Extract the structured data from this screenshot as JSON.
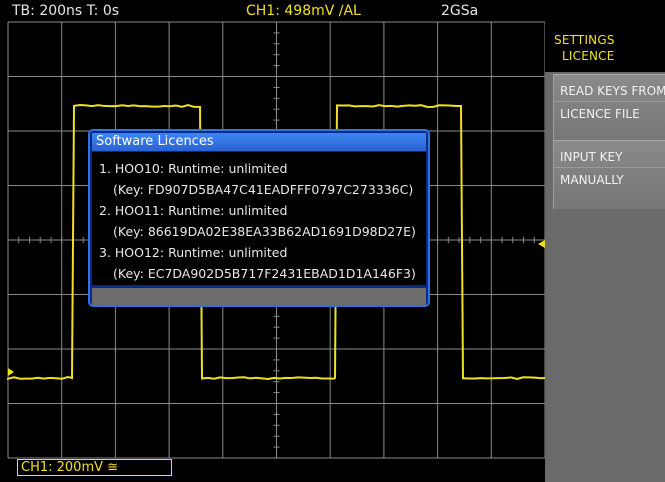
{
  "status": {
    "timebase": "TB: 200ns  T: 0s",
    "channel": "CH1: 498mV ∕AL",
    "sample_rate": "2GSa"
  },
  "side_panel": {
    "title_line1": "SETTINGS",
    "title_line2": "LICENCE",
    "softkeys": [
      {
        "line1": "READ KEYS FROM",
        "line2": "LICENCE FILE"
      },
      {
        "line1": "INPUT KEY",
        "line2": "MANUALLY"
      }
    ]
  },
  "dialog": {
    "title": "Software Licences",
    "entries": [
      {
        "line": "1. HOO10: Runtime: unlimited",
        "key": "(Key: FD907D5BA47C41EADFFF0797C273336C)"
      },
      {
        "line": "2. HOO11: Runtime: unlimited",
        "key": "(Key: 86619DA02E38EA33B62AD1691D98D27E)"
      },
      {
        "line": "3. HOO12: Runtime: unlimited",
        "key": "(Key: EC7DA902D5B717F2431EBAD1D1A146F3)"
      }
    ]
  },
  "channel_box": "CH1: 200mV ≅",
  "colors": {
    "trace": "#f0e020",
    "grid": "#8a8a8a",
    "panel": "#6a6a6a",
    "dialog_title": "#3d86f0"
  }
}
